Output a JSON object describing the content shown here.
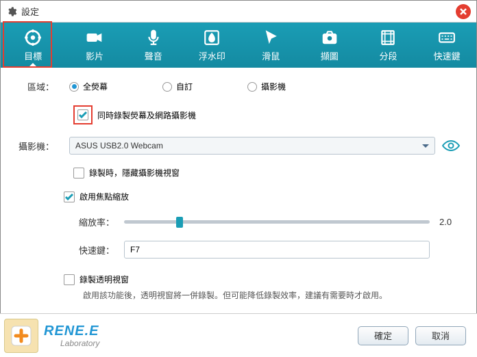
{
  "title": "設定",
  "tabs": [
    {
      "label": "目標"
    },
    {
      "label": "影片"
    },
    {
      "label": "聲音"
    },
    {
      "label": "浮水印"
    },
    {
      "label": "滑鼠"
    },
    {
      "label": "擷圖"
    },
    {
      "label": "分段"
    },
    {
      "label": "快速鍵"
    }
  ],
  "region": {
    "label": "區域：",
    "opts": {
      "full": "全熒幕",
      "custom": "自訂",
      "cam": "攝影機"
    }
  },
  "dualcam_label": "同時錄製熒幕及網路攝影機",
  "camera": {
    "label": "攝影機：",
    "value": "ASUS USB2.0 Webcam"
  },
  "hide_label": "錄製時，隱藏攝影機視窗",
  "focus_zoom_label": "啟用焦點縮放",
  "zoom": {
    "label": "縮放率：",
    "value": "2.0"
  },
  "hotkey": {
    "label": "快速鍵：",
    "value": "F7"
  },
  "transparent": {
    "label": "錄製透明視窗",
    "desc": "啟用該功能後，透明視窗將一併錄製。但可能降低錄製效率，建議有需要時才啟用。"
  },
  "brand": {
    "main": "RENE.E",
    "sub": "Laboratory"
  },
  "buttons": {
    "ok": "確定",
    "cancel": "取消"
  }
}
